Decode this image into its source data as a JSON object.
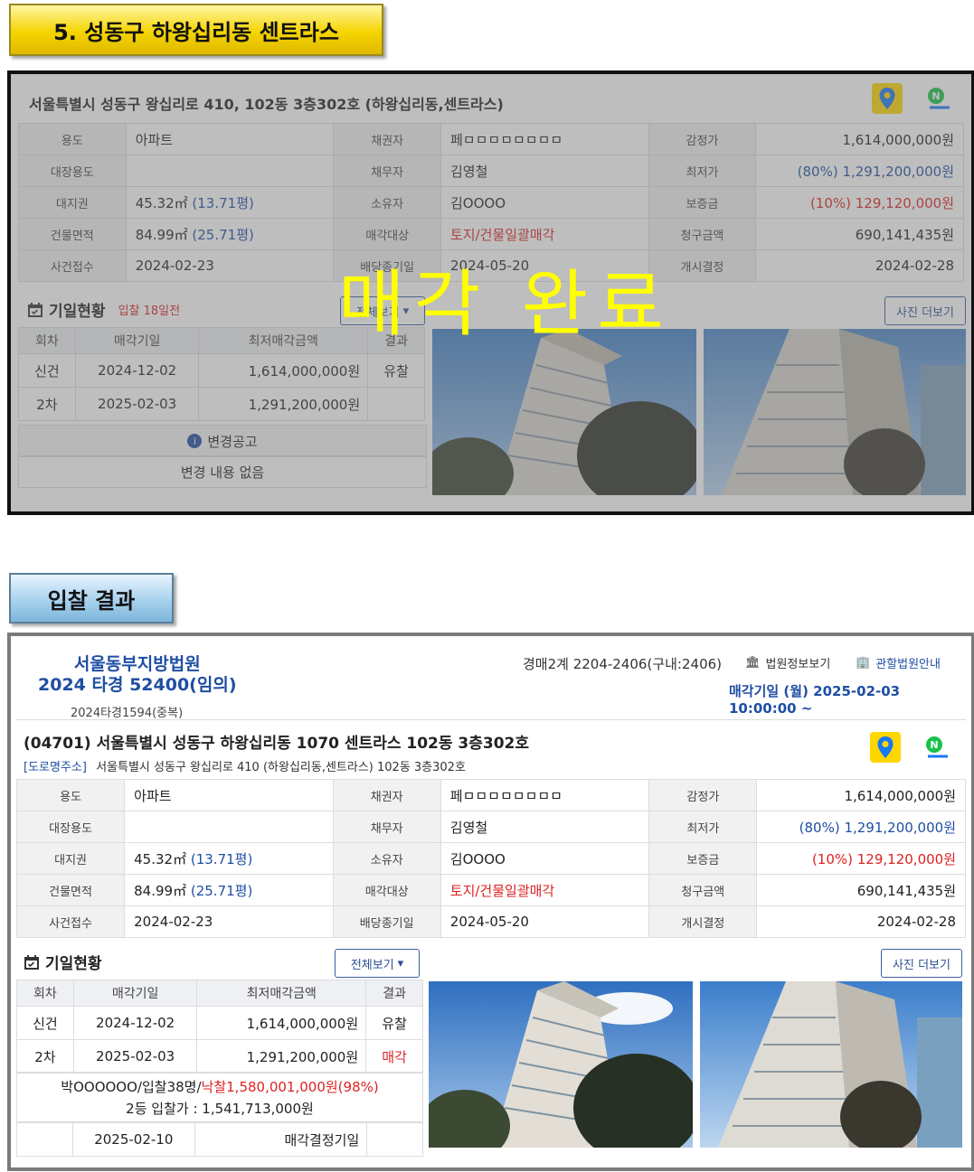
{
  "badges": {
    "section5": "5. 성동구 하왕십리동 센트라스",
    "result": "입찰 결과"
  },
  "top": {
    "address": "서울특별시 성동구 왕십리로 410, 102동 3층302호 (하왕십리동,센트라스)",
    "rows": [
      [
        "용도",
        "아파트",
        "채권자",
        "페ㅁㅁㅁㅁㅁㅁㅁㅁ",
        "감정가",
        "1,614,000,000원"
      ],
      [
        "대장용도",
        "",
        "채무자",
        "김영철",
        "최저가",
        "(80%) 1,291,200,000원"
      ],
      [
        "대지권",
        "45.32㎡ (13.71평)",
        "소유자",
        "김OOOO",
        "보증금",
        "(10%) 129,120,000원"
      ],
      [
        "건물면적",
        "84.99㎡ (25.71평)",
        "매각대상",
        "토지/건물일괄매각",
        "청구금액",
        "690,141,435원"
      ],
      [
        "사건접수",
        "2024-02-23",
        "배당종기일",
        "2024-05-20",
        "개시결정",
        "2024-02-28"
      ]
    ],
    "schedule_title": "기일현황",
    "schedule_note": "입찰 18일전",
    "view_all": "전체보기",
    "more_photos": "사진 더보기",
    "hist_headers": [
      "회차",
      "매각기일",
      "최저매각금액",
      "결과"
    ],
    "hist_rows": [
      [
        "신건",
        "2024-12-02",
        "1,614,000,000원",
        "유찰"
      ],
      [
        "2차",
        "2025-02-03",
        "1,291,200,000원",
        ""
      ]
    ],
    "notice_title": "변경공고",
    "notice_body": "변경 내용 없음",
    "stamp": "매각 완료"
  },
  "bottom": {
    "court": "서울동부지방법원",
    "case_no": "2024 타경 52400(임의)",
    "dup_case": "2024타경1594(중복)",
    "dept": "경매2계 2204-2406(구내:2406)",
    "court_info": "법원정보보기",
    "court_guide": "관할법원안내",
    "sale_date": "매각기일 (월) 2025-02-03 10:00:00 ~",
    "address": "(04701) 서울특별시 성동구 하왕십리동 1070 센트라스 102동 3층302호",
    "road_tag": "[도로명주소]",
    "road_addr": "서울특별시 성동구 왕십리로 410 (하왕십리동,센트라스) 102동 3층302호",
    "rows": [
      [
        "용도",
        "아파트",
        "채권자",
        "페ㅁㅁㅁㅁㅁㅁㅁㅁ",
        "감정가",
        "1,614,000,000원"
      ],
      [
        "대장용도",
        "",
        "채무자",
        "김영철",
        "최저가",
        "(80%) 1,291,200,000원"
      ],
      [
        "대지권",
        "45.32㎡ (13.71평)",
        "소유자",
        "김OOOO",
        "보증금",
        "(10%) 129,120,000원"
      ],
      [
        "건물면적",
        "84.99㎡ (25.71평)",
        "매각대상",
        "토지/건물일괄매각",
        "청구금액",
        "690,141,435원"
      ],
      [
        "사건접수",
        "2024-02-23",
        "배당종기일",
        "2024-05-20",
        "개시결정",
        "2024-02-28"
      ]
    ],
    "schedule_title": "기일현황",
    "view_all": "전체보기",
    "more_photos": "사진 더보기",
    "hist_headers": [
      "회차",
      "매각기일",
      "최저매각금액",
      "결과"
    ],
    "hist_rows": [
      [
        "신건",
        "2024-12-02",
        "1,614,000,000원",
        "유찰"
      ],
      [
        "2차",
        "2025-02-03",
        "1,291,200,000원",
        "매각"
      ]
    ],
    "winner_prefix": "박OOOOOO/입찰38명/",
    "winner_price": "낙찰1,580,001,000원(98%)",
    "second_bid": "2등 입찰가 : 1,541,713,000원",
    "decision_date": "2025-02-10",
    "decision_label": "매각결정기일"
  },
  "colors": {
    "accent_blue": "#1f4ea3",
    "accent_red": "#d22222",
    "stamp_yellow": "#ffff00"
  }
}
